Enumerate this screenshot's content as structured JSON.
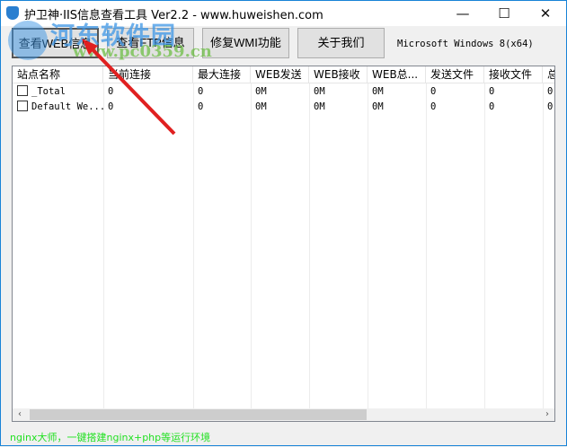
{
  "window": {
    "title": "护卫神·IIS信息查看工具 Ver2.2 - www.huweishen.com",
    "minimize": "—",
    "maximize": "☐",
    "close": "✕"
  },
  "toolbar": {
    "buttons": [
      "查看WEB信息",
      "查看FTP信息",
      "修复WMI功能",
      "关于我们"
    ],
    "os_info": "Microsoft Windows 8(x64)"
  },
  "table": {
    "columns": [
      "站点名称",
      "当前连接",
      "最大连接",
      "WEB发送",
      "WEB接收",
      "WEB总...",
      "发送文件",
      "接收文件",
      "总"
    ],
    "rows": [
      [
        "_Total",
        "0",
        "0",
        "0M",
        "0M",
        "0M",
        "0",
        "0",
        "0"
      ],
      [
        "Default We...",
        "0",
        "0",
        "0M",
        "0M",
        "0M",
        "0",
        "0",
        "0"
      ]
    ]
  },
  "scrollbar": {
    "left": "‹",
    "right": "›"
  },
  "status": "nginx大师，一键搭建nginx+php等运行环境",
  "watermark": {
    "name": "河东软件园",
    "url": "www.pc0359.cn"
  },
  "colors": {
    "status": "#22e022",
    "arrow": "#e02020"
  }
}
